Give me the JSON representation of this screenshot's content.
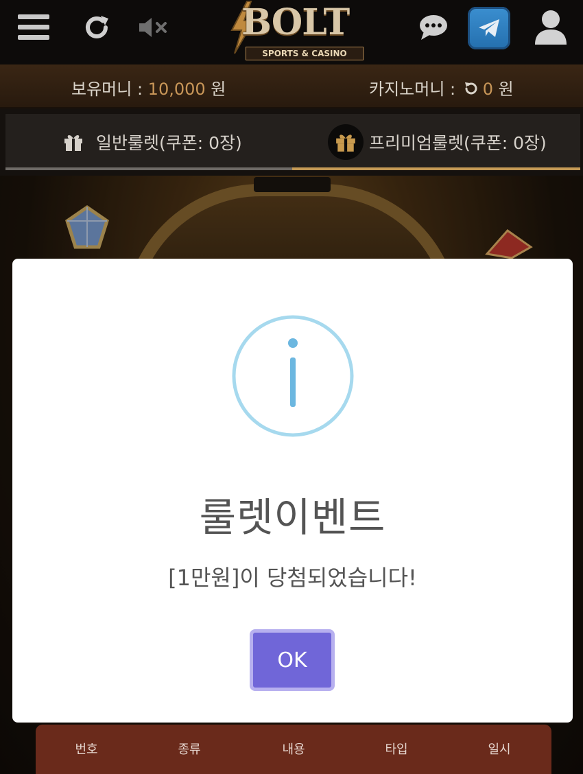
{
  "header": {
    "logo_text": "BOLT",
    "logo_subtext": "SPORTS & CASINO",
    "icons": [
      "menu-icon",
      "reload-icon",
      "mute-icon",
      "chat-icon",
      "telegram-icon",
      "user-icon"
    ]
  },
  "balance": {
    "money_label": "보유머니 : ",
    "money_value": "10,000",
    "money_unit": " 원",
    "casino_label": "카지노머니 : ",
    "casino_value": "0",
    "casino_unit": " 원"
  },
  "tabs": [
    {
      "label": "일반룰렛(쿠폰: 0장)"
    },
    {
      "label": "프리미엄룰렛(쿠폰: 0장)"
    }
  ],
  "table": {
    "columns": [
      "번호",
      "종류",
      "내용",
      "타입",
      "일시"
    ]
  },
  "modal": {
    "title": "룰렛이벤트",
    "message": "[1만원]이 당첨되었습니다!",
    "ok_label": "OK"
  },
  "colors": {
    "accent_gold": "#c89658",
    "modal_button": "#7066d8",
    "info_icon": "#6cb7e0",
    "table_header": "#6a2a1b"
  }
}
